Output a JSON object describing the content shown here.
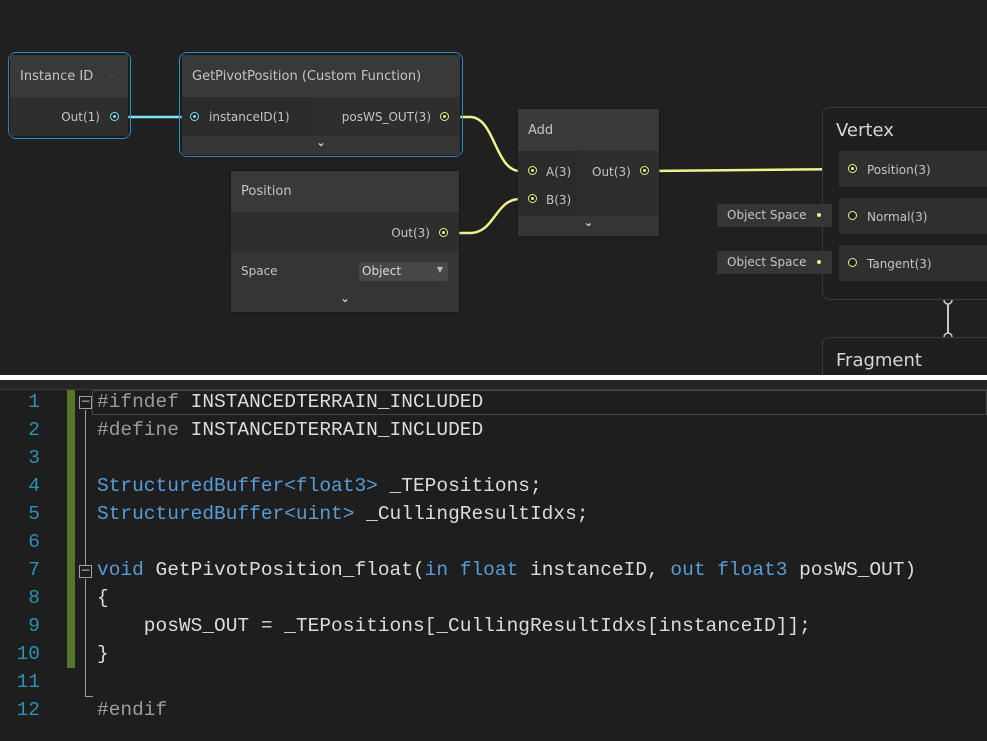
{
  "graph": {
    "instance_node": {
      "title": "Instance ID",
      "out": "Out(1)"
    },
    "custom_function_node": {
      "title": "GetPivotPosition (Custom Function)",
      "input": "instanceID(1)",
      "output": "posWS_OUT(3)"
    },
    "position_node": {
      "title": "Position",
      "out": "Out(3)",
      "space_label": "Space",
      "space_value": "Object"
    },
    "add_node": {
      "title": "Add",
      "input_a": "A(3)",
      "input_b": "B(3)",
      "out": "Out(3)"
    },
    "vertex_context": {
      "title": "Vertex",
      "slots": [
        "Position(3)",
        "Normal(3)",
        "Tangent(3)"
      ],
      "normal_default": "Object Space",
      "tangent_default": "Object Space"
    },
    "fragment_context": {
      "title": "Fragment"
    },
    "colors": {
      "vector1_wire": "#7fe3f0",
      "vector3_wire": "#f0f08c",
      "selection": "#2d8fc9"
    }
  },
  "code": {
    "line_numbers": [
      "1",
      "2",
      "3",
      "4",
      "5",
      "6",
      "7",
      "8",
      "9",
      "10",
      "11",
      "12"
    ],
    "lines": [
      [
        [
          "pp",
          "#ifndef "
        ],
        [
          "id",
          "INSTANCEDTERRAIN_INCLUDED"
        ]
      ],
      [
        [
          "pp",
          "#define "
        ],
        [
          "id",
          "INSTANCEDTERRAIN_INCLUDED"
        ]
      ],
      [],
      [
        [
          "kw",
          "StructuredBuffer<float3>"
        ],
        [
          "id",
          " _TEPositions;"
        ]
      ],
      [
        [
          "kw",
          "StructuredBuffer<uint>"
        ],
        [
          "id",
          " _CullingResultIdxs;"
        ]
      ],
      [],
      [
        [
          "kw",
          "void"
        ],
        [
          "id",
          " GetPivotPosition_float("
        ],
        [
          "kw",
          "in"
        ],
        [
          "id",
          " "
        ],
        [
          "kw",
          "float"
        ],
        [
          "id",
          " instanceID, "
        ],
        [
          "kw",
          "out"
        ],
        [
          "id",
          " "
        ],
        [
          "kw",
          "float3"
        ],
        [
          "id",
          " posWS_OUT)"
        ]
      ],
      [
        [
          "id",
          "{"
        ]
      ],
      [
        [
          "id",
          "    posWS_OUT = _TEPositions[_CullingResultIdxs[instanceID]];"
        ]
      ],
      [
        [
          "id",
          "}"
        ]
      ],
      [],
      [
        [
          "pp",
          "#endif"
        ]
      ]
    ]
  }
}
